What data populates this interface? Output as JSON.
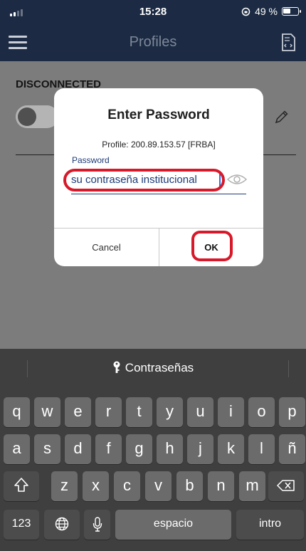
{
  "status_bar": {
    "time": "15:28",
    "battery": "49 %"
  },
  "header": {
    "title": "Profiles"
  },
  "main": {
    "status": "DISCONNECTED"
  },
  "dialog": {
    "title": "Enter Password",
    "profile": "Profile: 200.89.153.57 [FRBA]",
    "password_label": "Password",
    "password_value": "su contraseña institucional",
    "cancel": "Cancel",
    "ok": "OK"
  },
  "keyboard": {
    "suggestion": "Contraseñas",
    "row1": [
      "q",
      "w",
      "e",
      "r",
      "t",
      "y",
      "u",
      "i",
      "o",
      "p"
    ],
    "row2": [
      "a",
      "s",
      "d",
      "f",
      "g",
      "h",
      "j",
      "k",
      "l",
      "ñ"
    ],
    "row3": [
      "z",
      "x",
      "c",
      "v",
      "b",
      "n",
      "m"
    ],
    "numbers": "123",
    "space": "espacio",
    "return": "intro"
  },
  "icons": {
    "menu": "hamburger-menu-icon",
    "doc": "import-profile-icon",
    "pencil": "edit-pencil-icon",
    "eye": "show-password-eye-icon",
    "key": "key-icon",
    "shift": "shift-icon",
    "delete": "delete-backspace-icon",
    "globe": "globe-icon",
    "mic": "microphone-icon"
  },
  "colors": {
    "header_bg": "#1c2b43",
    "highlight": "#d7192a",
    "accent": "#1d3a78"
  }
}
